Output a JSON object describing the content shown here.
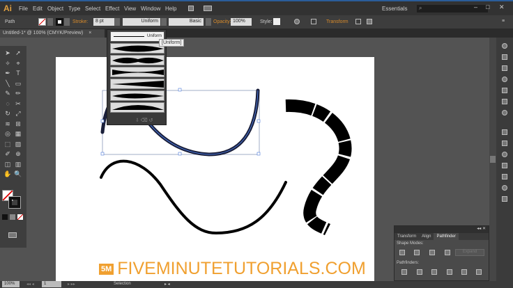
{
  "app": {
    "logo": "Ai",
    "menu": [
      "File",
      "Edit",
      "Object",
      "Type",
      "Select",
      "Effect",
      "View",
      "Window",
      "Help"
    ],
    "workspace": "Essentials",
    "search_placeholder": ""
  },
  "control": {
    "selection": "Path",
    "stroke_label": "Stroke:",
    "stroke_value": "8 pt",
    "profile": "Uniform",
    "brush": "Basic",
    "opacity_label": "Opacity:",
    "opacity_value": "100%",
    "style_label": "Style:",
    "transform_label": "Transform"
  },
  "document_tab": {
    "title": "Untitled-1* @ 100% (CMYK/Preview)",
    "close": "×"
  },
  "profile_popup": {
    "first": "Uniform",
    "tooltip": "[Uniform]"
  },
  "pathfinder": {
    "tabs": [
      "Transform",
      "Align",
      "Pathfinder"
    ],
    "shape_modes": "Shape Modes:",
    "expand": "Expand",
    "pathfinders": "Pathfinders:"
  },
  "status": {
    "zoom": "100%",
    "artboard": "1",
    "tool": "Selection"
  },
  "watermark": {
    "badge": "5M",
    "text": "FIVEMINUTETUTORIALS.COM",
    "color": "#f0a030"
  }
}
